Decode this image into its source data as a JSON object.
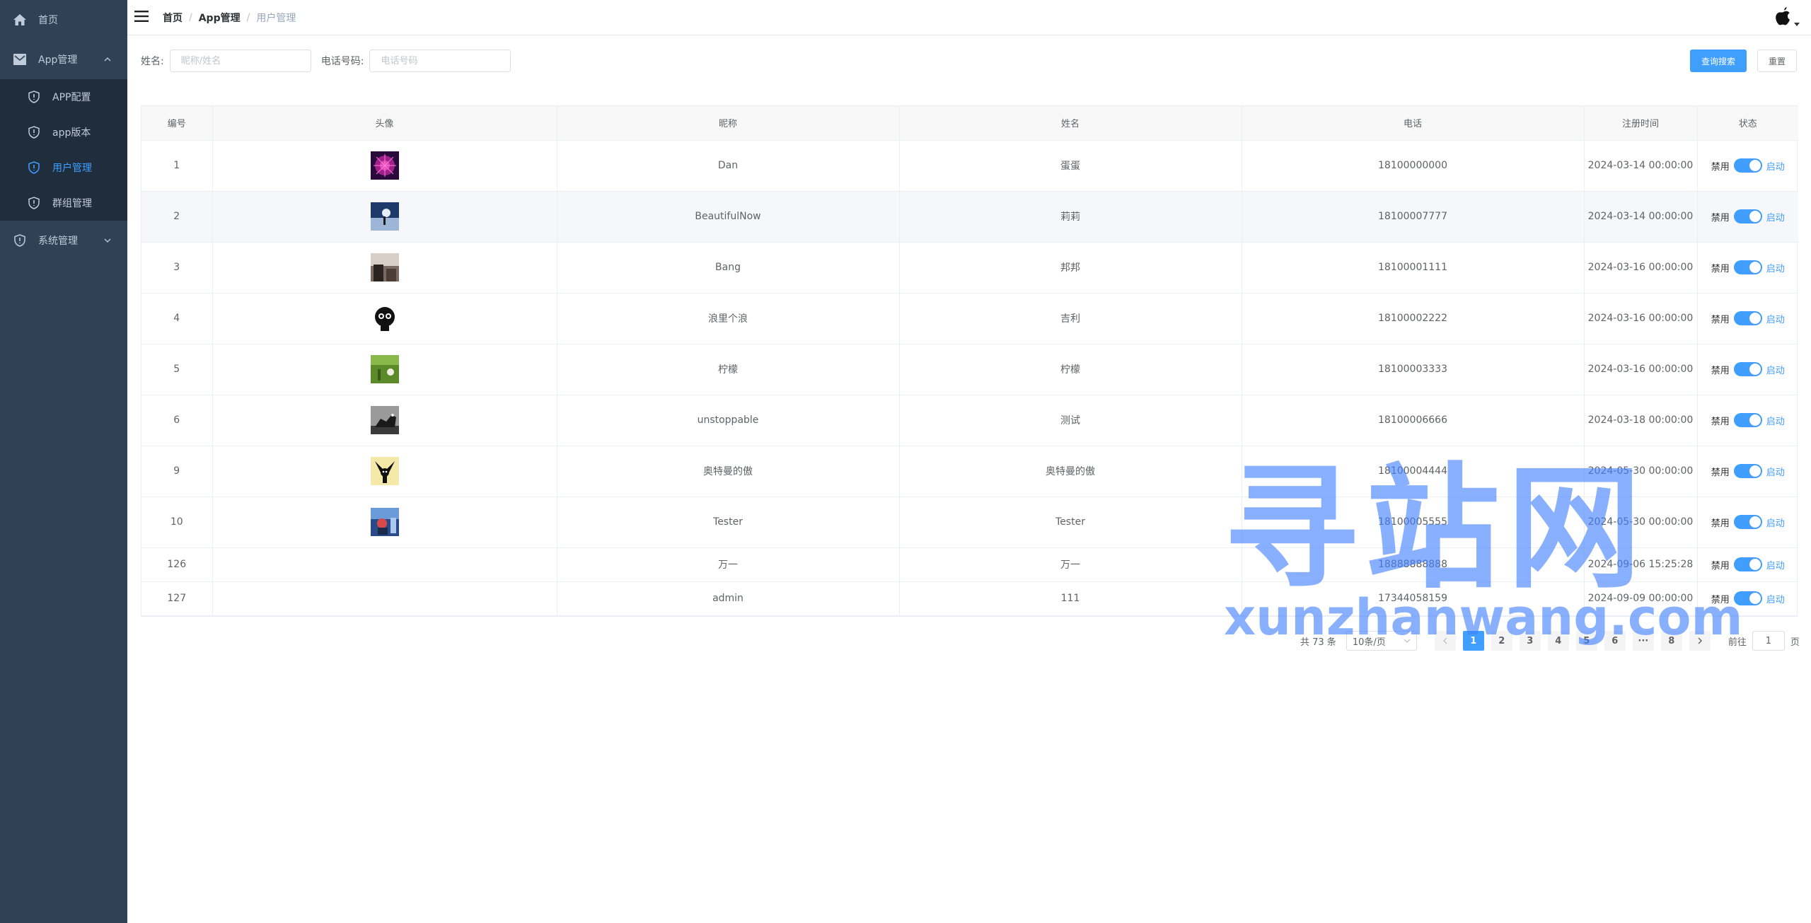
{
  "sidebar": {
    "home": "首页",
    "app_mgmt": "App管理",
    "app_sub": [
      {
        "label": "APP配置"
      },
      {
        "label": "app版本"
      },
      {
        "label": "用户管理"
      },
      {
        "label": "群组管理"
      }
    ],
    "sys_mgmt": "系统管理",
    "active_color": "#409eff"
  },
  "header": {
    "breadcrumb": [
      "首页",
      "App管理",
      "用户管理"
    ],
    "separator": "/"
  },
  "search": {
    "name_label": "姓名:",
    "name_placeholder": "昵称/姓名",
    "phone_label": "电话号码:",
    "phone_placeholder": "电话号码",
    "search_button": "查询搜索",
    "reset_button": "重置"
  },
  "table": {
    "columns": [
      "编号",
      "头像",
      "昵称",
      "姓名",
      "电话",
      "注册时间",
      "状态"
    ],
    "rows": [
      {
        "id": "1",
        "nickname": "Dan",
        "name": "蛋蛋",
        "phone": "18100000000",
        "reg": "2024-03-14 00:00:00"
      },
      {
        "id": "2",
        "nickname": "BeautifulNow",
        "name": "莉莉",
        "phone": "18100007777",
        "reg": "2024-03-14 00:00:00"
      },
      {
        "id": "3",
        "nickname": "Bang",
        "name": "邦邦",
        "phone": "18100001111",
        "reg": "2024-03-16 00:00:00"
      },
      {
        "id": "4",
        "nickname": "浪里个浪",
        "name": "吉利",
        "phone": "18100002222",
        "reg": "2024-03-16 00:00:00"
      },
      {
        "id": "5",
        "nickname": "柠檬",
        "name": "柠檬",
        "phone": "18100003333",
        "reg": "2024-03-16 00:00:00"
      },
      {
        "id": "6",
        "nickname": "unstoppable",
        "name": "测试",
        "phone": "18100006666",
        "reg": "2024-03-18 00:00:00"
      },
      {
        "id": "9",
        "nickname": "奥特曼的傲",
        "name": "奥特曼的傲",
        "phone": "18100004444",
        "reg": "2024-05-30 00:00:00"
      },
      {
        "id": "10",
        "nickname": "Tester",
        "name": "Tester",
        "phone": "18100005555",
        "reg": "2024-05-30 00:00:00"
      },
      {
        "id": "126",
        "nickname": "万一",
        "name": "万一",
        "phone": "18888888888",
        "reg": "2024-09-06 15:25:28"
      },
      {
        "id": "127",
        "nickname": "admin",
        "name": "111",
        "phone": "17344058159",
        "reg": "2024-09-09 00:00:00"
      }
    ],
    "status_off": "禁用",
    "status_on": "启动"
  },
  "pagination": {
    "total": "共 73 条",
    "page_size": "10条/页",
    "pages": [
      "1",
      "2",
      "3",
      "4",
      "5",
      "6",
      "···",
      "8"
    ],
    "current": "1",
    "goto_prefix": "前往",
    "goto_value": "1",
    "goto_suffix": "页"
  },
  "watermark": {
    "cn": "寻站网",
    "en": "xunzhanwang.com"
  }
}
